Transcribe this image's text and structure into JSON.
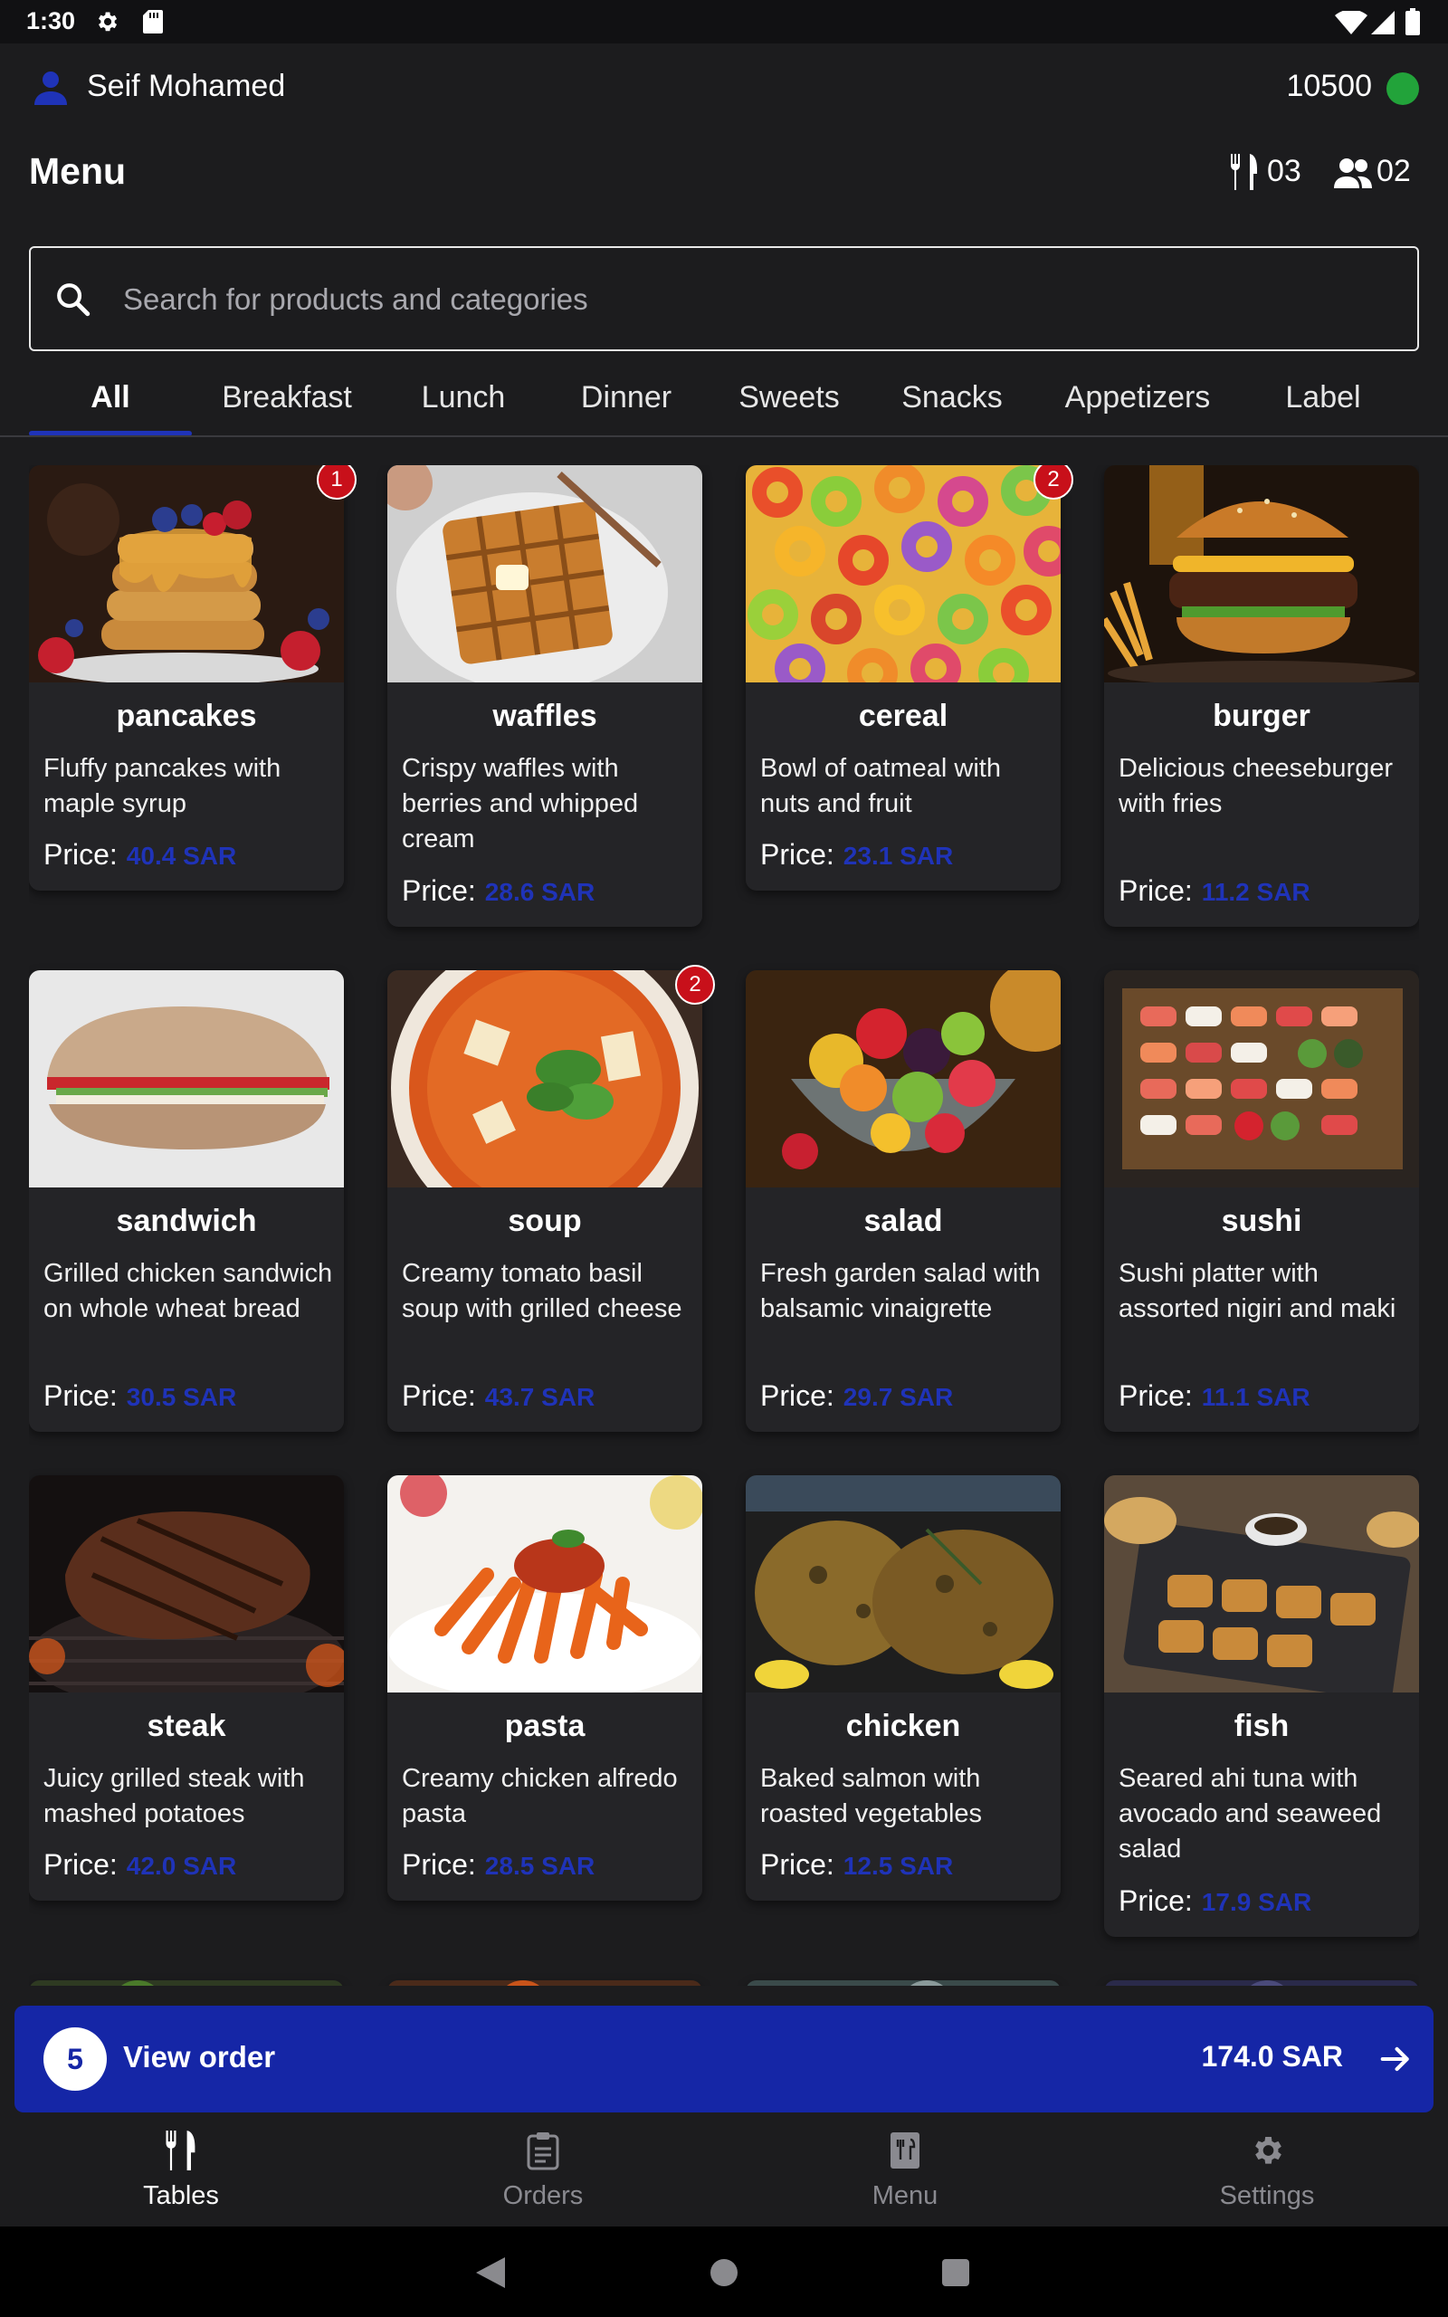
{
  "status_bar": {
    "time": "1:30"
  },
  "user": {
    "name": "Seif Mohamed",
    "balance": "10500"
  },
  "header": {
    "title": "Menu",
    "tables_count": "03",
    "guests_count": "02"
  },
  "search": {
    "placeholder": "Search for products and categories",
    "value": ""
  },
  "tabs": [
    {
      "label": "All",
      "active": true
    },
    {
      "label": "Breakfast"
    },
    {
      "label": "Lunch"
    },
    {
      "label": "Dinner"
    },
    {
      "label": "Sweets"
    },
    {
      "label": "Snacks"
    },
    {
      "label": "Appetizers"
    },
    {
      "label": "Label"
    }
  ],
  "price_label": "Price:",
  "products": [
    {
      "name": "pancakes",
      "description": "Fluffy pancakes with maple syrup",
      "price": "40.4 SAR",
      "badge": "1"
    },
    {
      "name": "waffles",
      "description": "Crispy waffles with berries and whipped cream",
      "price": "28.6 SAR"
    },
    {
      "name": "cereal",
      "description": "Bowl of oatmeal with nuts and fruit",
      "price": "23.1 SAR",
      "badge": "2"
    },
    {
      "name": "burger",
      "description": "Delicious cheeseburger with fries",
      "price": "11.2 SAR"
    },
    {
      "name": "sandwich",
      "description": "Grilled chicken sandwich on whole wheat bread",
      "price": "30.5 SAR"
    },
    {
      "name": "soup",
      "description": "Creamy tomato basil soup with grilled cheese",
      "price": "43.7 SAR",
      "badge": "2"
    },
    {
      "name": "salad",
      "description": "Fresh garden salad with balsamic vinaigrette",
      "price": "29.7 SAR"
    },
    {
      "name": "sushi",
      "description": "Sushi platter with assorted nigiri and maki",
      "price": "11.1 SAR"
    },
    {
      "name": "steak",
      "description": "Juicy grilled steak with mashed potatoes",
      "price": "42.0 SAR"
    },
    {
      "name": "pasta",
      "description": "Creamy chicken alfredo pasta",
      "price": "28.5 SAR"
    },
    {
      "name": "chicken",
      "description": "Baked salmon with roasted vegetables",
      "price": "12.5 SAR"
    },
    {
      "name": "fish",
      "description": "Seared ahi tuna with avocado and seaweed salad",
      "price": "17.9 SAR"
    }
  ],
  "order_bar": {
    "count": "5",
    "label": "View order",
    "total": "174.0 SAR"
  },
  "bottom_nav": [
    {
      "label": "Tables",
      "icon": "fork-knife-icon",
      "active": true
    },
    {
      "label": "Orders",
      "icon": "clipboard-icon"
    },
    {
      "label": "Menu",
      "icon": "menu-book-icon"
    },
    {
      "label": "Settings",
      "icon": "gear-icon"
    }
  ],
  "colors": {
    "accent": "#1f33b8",
    "order_bar": "#1526a6",
    "badge": "#c8101a",
    "balance_dot": "#22a33a",
    "background": "#1c1c1e",
    "card": "#242427"
  }
}
